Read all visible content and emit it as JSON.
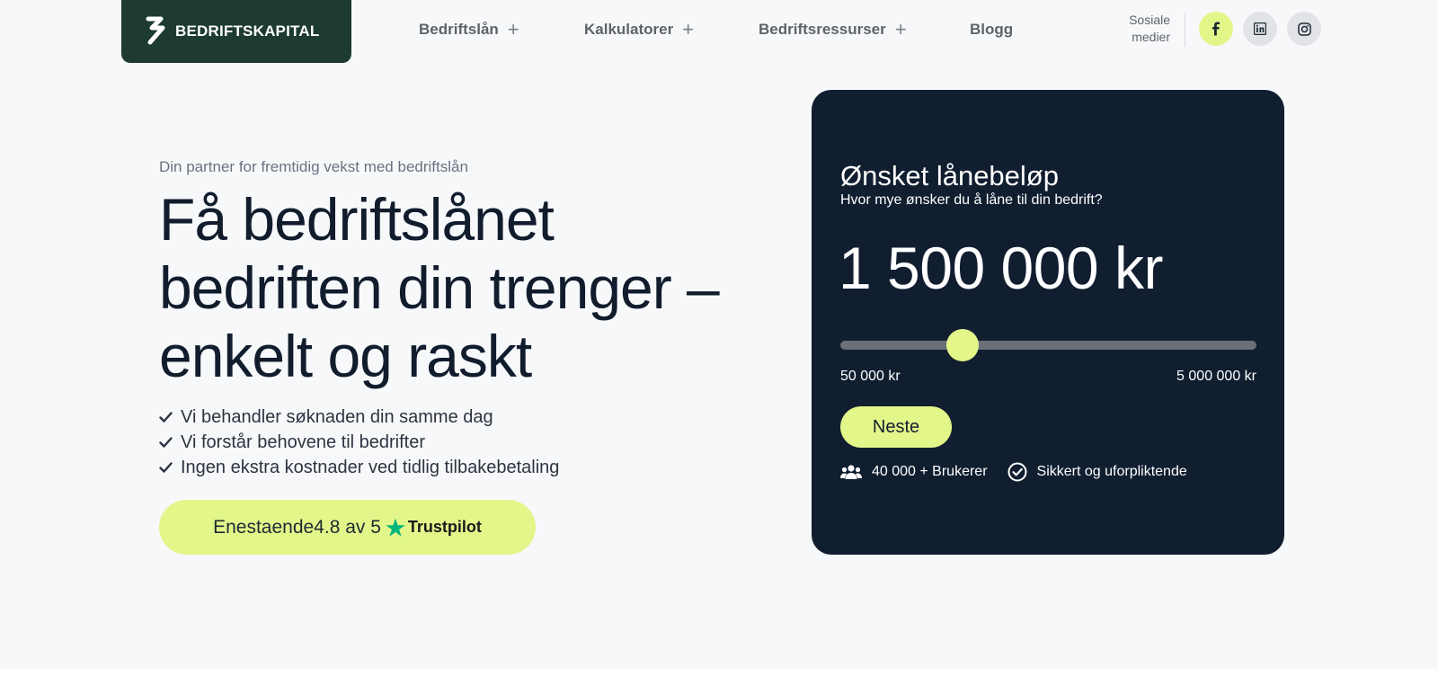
{
  "brand": {
    "name": "BEDRIFTSKAPITAL"
  },
  "nav": {
    "items": [
      {
        "label": "Bedriftslån",
        "has_submenu": true
      },
      {
        "label": "Kalkulatorer",
        "has_submenu": true
      },
      {
        "label": "Bedriftsressurser",
        "has_submenu": true
      },
      {
        "label": "Blogg",
        "has_submenu": false
      }
    ],
    "plus_glyph": "+"
  },
  "social": {
    "label_line1": "Sosiale",
    "label_line2": "medier",
    "icons": [
      "facebook-icon",
      "linkedin-icon",
      "instagram-icon"
    ]
  },
  "hero": {
    "tagline": "Din partner for fremtidig vekst med bedriftslån",
    "headline": "Få bedriftslånet bedriften din trenger – enkelt og raskt",
    "benefits": [
      "Vi behandler søknaden din samme dag",
      "Vi forstår behovene til bedrifter",
      "Ingen ekstra kostnader ved tidlig tilbakebetaling"
    ],
    "trust": {
      "rating_text": "Enestaende4.8 av 5",
      "brand": "Trustpilot"
    }
  },
  "loan_card": {
    "title": "Ønsket lånebeløp",
    "subtitle": "Hvor mye ønsker du å låne til din bedrift?",
    "amount": "1 500 000 kr",
    "amount_value": 1500000,
    "min_label": "50 000 kr",
    "max_label": "5 000 000 kr",
    "min_value": 50000,
    "max_value": 5000000,
    "next_label": "Neste",
    "stats": [
      {
        "icon": "users-icon",
        "label": "40 000 + Brukerer"
      },
      {
        "icon": "check-circle-icon",
        "label": "Sikkert og uforpliktende"
      }
    ]
  },
  "colors": {
    "brand_dark": "#1d3b33",
    "accent_lime": "#e3f68a",
    "card_navy": "#111e30",
    "trustpilot_green": "#00b67a"
  }
}
